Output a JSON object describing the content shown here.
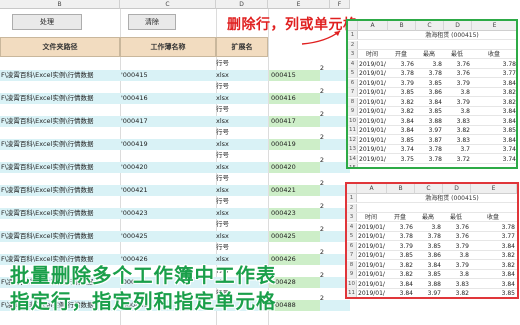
{
  "column_headers": [
    "B",
    "C",
    "D",
    "E",
    "F"
  ],
  "toolbar": {
    "process_label": "处理",
    "clear_label": "清除"
  },
  "table_headers": {
    "path": "文件夹路径",
    "sheet_name": "工作薄名称",
    "extension": "扩展名"
  },
  "rows": [
    {
      "path": "F\\凌霄百科\\Excel实例\\行情数据",
      "code": "'000415",
      "type": "行号",
      "ext": "xlsx",
      "num": "000415",
      "count": "2"
    },
    {
      "path": "F\\凌霄百科\\Excel实例\\行情数据",
      "code": "'000416",
      "type": "行号",
      "ext": "xlsx",
      "num": "000416",
      "count": "2"
    },
    {
      "path": "F\\凌霄百科\\Excel实例\\行情数据",
      "code": "'000417",
      "type": "行号",
      "ext": "xlsx",
      "num": "000417",
      "count": "2"
    },
    {
      "path": "F\\凌霄百科\\Excel实例\\行情数据",
      "code": "'000419",
      "type": "行号",
      "ext": "xlsx",
      "num": "000419",
      "count": "2"
    },
    {
      "path": "F\\凌霄百科\\Excel实例\\行情数据",
      "code": "'000420",
      "type": "行号",
      "ext": "xlsx",
      "num": "000420",
      "count": "2"
    },
    {
      "path": "F\\凌霄百科\\Excel实例\\行情数据",
      "code": "'000421",
      "type": "行号",
      "ext": "xlsx",
      "num": "000421",
      "count": "2"
    },
    {
      "path": "F\\凌霄百科\\Excel实例\\行情数据",
      "code": "'000423",
      "type": "行号",
      "ext": "xlsx",
      "num": "000423",
      "count": "2"
    },
    {
      "path": "F\\凌霄百科\\Excel实例\\行情数据",
      "code": "'000425",
      "type": "行号",
      "ext": "xlsx",
      "num": "000425",
      "count": "2"
    },
    {
      "path": "F\\凌霄百科\\Excel实例\\行情数据",
      "code": "'000426",
      "type": "行号",
      "ext": "xlsx",
      "num": "000426",
      "count": "2"
    },
    {
      "path": "F\\凌霄百科\\Excel实例\\行情数据",
      "code": "'000428",
      "type": "行号",
      "ext": "xlsx",
      "num": "000428",
      "count": "2"
    },
    {
      "path": "F\\凌霄百科\\Excel实例\\行情数据",
      "code": "'000488",
      "type": "行号",
      "ext": "xlsx",
      "num": "000488",
      "count": "2"
    }
  ],
  "delete_note": "删除行，列或单元格",
  "caption_line1": "批量删除多个工作簿中工作表",
  "caption_line2": "指定行，指定列和指定单元格",
  "inset_top": {
    "columns": [
      "A",
      "B",
      "C",
      "D",
      "E"
    ],
    "title": "渤海租赁 (000415)",
    "headers": [
      "时间",
      "开盘",
      "最高",
      "最低",
      "收盘"
    ],
    "rows": [
      [
        "2019/01/",
        "3.76",
        "3.8",
        "3.76",
        "3.78"
      ],
      [
        "2019/01/",
        "3.78",
        "3.78",
        "3.76",
        "3.77"
      ],
      [
        "2019/01/",
        "3.79",
        "3.85",
        "3.79",
        "3.84"
      ],
      [
        "2019/01/",
        "3.85",
        "3.86",
        "3.8",
        "3.82"
      ],
      [
        "2019/01/",
        "3.82",
        "3.84",
        "3.79",
        "3.82"
      ],
      [
        "2019/01/",
        "3.82",
        "3.85",
        "3.8",
        "3.84"
      ],
      [
        "2019/01/",
        "3.84",
        "3.88",
        "3.83",
        "3.84"
      ],
      [
        "2019/01/",
        "3.84",
        "3.97",
        "3.82",
        "3.85"
      ],
      [
        "2019/01/",
        "3.85",
        "3.87",
        "3.83",
        "3.84"
      ],
      [
        "2019/01/",
        "3.74",
        "3.78",
        "3.7",
        "3.74"
      ],
      [
        "2019/01/",
        "3.75",
        "3.78",
        "3.72",
        "3.74"
      ]
    ],
    "row_numbers": [
      "1",
      "2",
      "3",
      "4",
      "5",
      "6",
      "7",
      "8",
      "9",
      "10",
      "11",
      "12",
      "13",
      "14",
      "15"
    ]
  },
  "inset_bottom": {
    "columns": [
      "A",
      "B",
      "C",
      "D",
      "E"
    ],
    "title": "渤海租赁 (000415)",
    "headers": [
      "时间",
      "开盘",
      "最高",
      "最低",
      "收盘"
    ],
    "rows": [
      [
        "2019/01/",
        "3.76",
        "3.8",
        "3.76",
        "3.78"
      ],
      [
        "2019/01/",
        "3.78",
        "3.78",
        "3.76",
        "3.77"
      ],
      [
        "2019/01/",
        "3.79",
        "3.85",
        "3.79",
        "3.84"
      ],
      [
        "2019/01/",
        "3.85",
        "3.86",
        "3.8",
        "3.82"
      ],
      [
        "2019/01/",
        "3.82",
        "3.84",
        "3.79",
        "3.82"
      ],
      [
        "2019/01/",
        "3.82",
        "3.85",
        "3.8",
        "3.84"
      ],
      [
        "2019/01/",
        "3.84",
        "3.88",
        "3.83",
        "3.84"
      ],
      [
        "2019/01/",
        "3.84",
        "3.97",
        "3.82",
        "3.85"
      ],
      [
        "2019/01/",
        "3.85",
        "3.87",
        "3.83",
        "3.84"
      ],
      [
        "2019/01/",
        "3.74",
        "3.78",
        "3.7",
        "3.74"
      ]
    ],
    "row_numbers": [
      "1",
      "2",
      "3",
      "4",
      "5",
      "6",
      "7",
      "8",
      "9",
      "10",
      "11",
      "12",
      "13"
    ]
  }
}
